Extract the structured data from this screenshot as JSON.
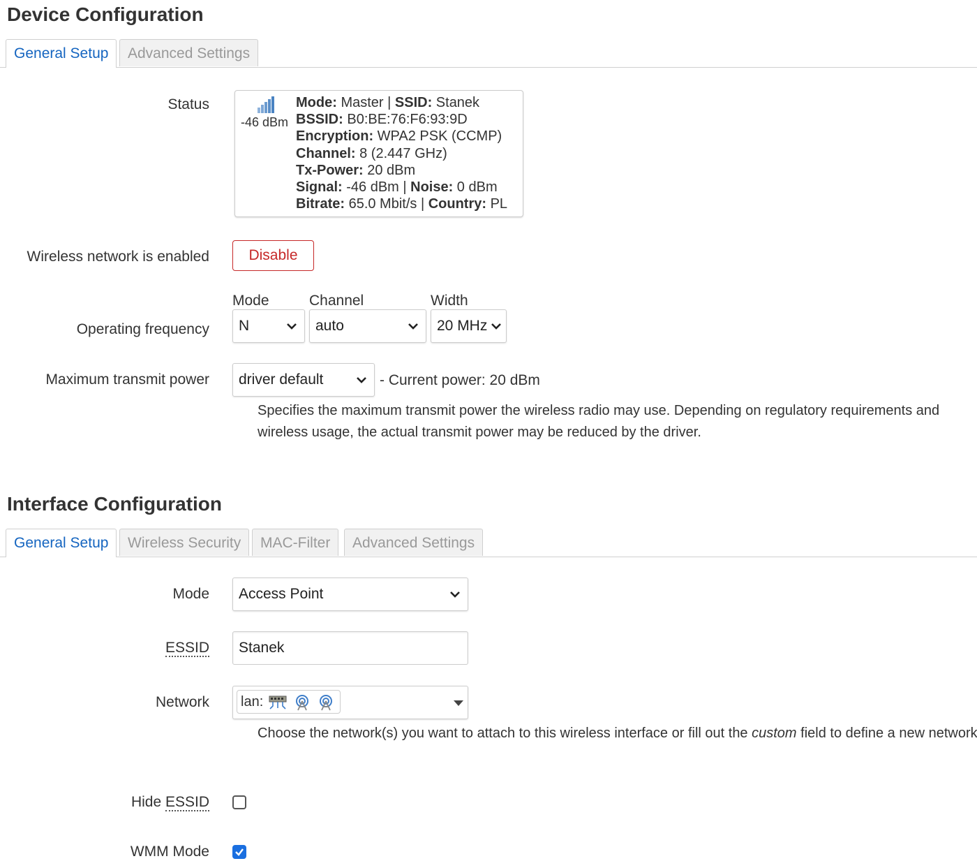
{
  "device": {
    "title": "Device Configuration",
    "tabs": [
      {
        "label": "General Setup",
        "active": true
      },
      {
        "label": "Advanced Settings",
        "active": false
      }
    ],
    "status": {
      "label": "Status",
      "signal_text": "-46 dBm",
      "lines": [
        [
          {
            "k": "Mode:",
            "v": " Master | "
          },
          {
            "k": "SSID:",
            "v": " Stanek"
          }
        ],
        [
          {
            "k": "BSSID:",
            "v": " B0:BE:76:F6:93:9D"
          }
        ],
        [
          {
            "k": "Encryption:",
            "v": " WPA2 PSK (CCMP)"
          }
        ],
        [
          {
            "k": "Channel:",
            "v": " 8 (2.447 GHz)"
          }
        ],
        [
          {
            "k": "Tx-Power:",
            "v": " 20 dBm"
          }
        ],
        [
          {
            "k": "Signal:",
            "v": " -46 dBm | "
          },
          {
            "k": "Noise:",
            "v": " 0 dBm"
          }
        ],
        [
          {
            "k": "Bitrate:",
            "v": " 65.0 Mbit/s | "
          },
          {
            "k": "Country:",
            "v": " PL"
          }
        ]
      ]
    },
    "wireless": {
      "label": "Wireless network is enabled",
      "button": "Disable"
    },
    "frequency": {
      "label": "Operating frequency",
      "mode_label": "Mode",
      "mode_value": "N",
      "channel_label": "Channel",
      "channel_value": "auto",
      "width_label": "Width",
      "width_value": "20 MHz"
    },
    "power": {
      "label": "Maximum transmit power",
      "value": "driver default",
      "current": "- Current power: 20 dBm",
      "help": "Specifies the maximum transmit power the wireless radio may use. Depending on regulatory requirements and wireless usage, the actual transmit power may be reduced by the driver."
    }
  },
  "iface": {
    "title": "Interface Configuration",
    "tabs": [
      {
        "label": "General Setup",
        "active": true
      },
      {
        "label": "Wireless Security",
        "active": false
      },
      {
        "label": "MAC-Filter",
        "active": false
      },
      {
        "label": "Advanced Settings",
        "active": false
      }
    ],
    "mode": {
      "label": "Mode",
      "value": "Access Point"
    },
    "essid": {
      "label": "ESSID",
      "value": "Stanek"
    },
    "network": {
      "label": "Network",
      "chip": "lan:",
      "help_before": "Choose the network(s) you want to attach to this wireless interface or fill out the ",
      "help_em": "custom",
      "help_after": " field to define a new network."
    },
    "hide_essid": {
      "label_prefix": "Hide ",
      "label_abbr": "ESSID",
      "checked": false
    },
    "wmm": {
      "label": "WMM Mode",
      "checked": true
    }
  },
  "colors": {
    "accent": "#1565c0",
    "danger": "#c62828",
    "checkbox": "#1a6fe0"
  }
}
